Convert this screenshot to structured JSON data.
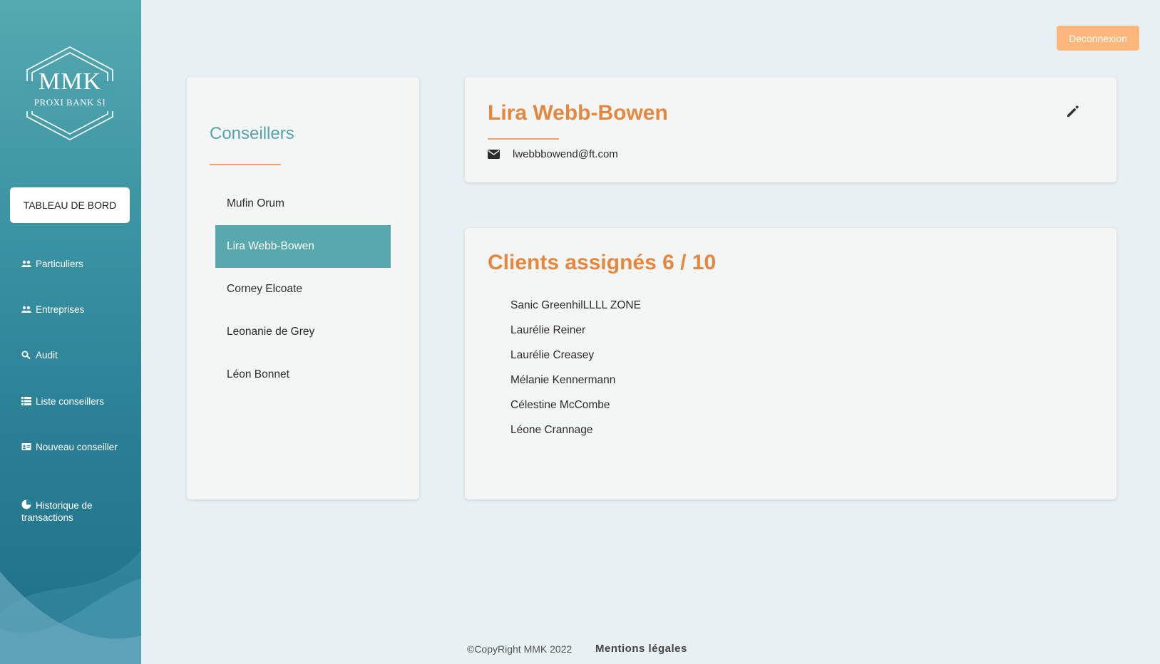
{
  "sidebar": {
    "logo": {
      "brand": "MMK",
      "subtitle": "PROXI BANK SI"
    },
    "dashboard_label": "TABLEAU DE BORD",
    "items": [
      {
        "label": "Particuliers",
        "icon": "users-icon"
      },
      {
        "label": "Entreprises",
        "icon": "users-icon"
      },
      {
        "label": "Audit",
        "icon": "search-icon"
      },
      {
        "label": "Liste conseillers",
        "icon": "list-icon"
      },
      {
        "label": "Nouveau conseiller",
        "icon": "id-card-icon"
      },
      {
        "label": "Historique de transactions",
        "icon": "pie-chart-icon"
      }
    ]
  },
  "header": {
    "logout_label": "Deconnexion"
  },
  "advisors_panel": {
    "title": "Conseillers",
    "items": [
      "Mufin Orum",
      "Lira Webb-Bowen",
      "Corney Elcoate",
      "Leonanie de Grey",
      "Léon Bonnet"
    ],
    "selected": "Lira Webb-Bowen"
  },
  "advisor_detail": {
    "name": "Lira Webb-Bowen",
    "email": "lwebbbowend@ft.com"
  },
  "clients": {
    "title": "Clients assignés 6 / 10",
    "items": [
      "Sanic GreenhilLLLL ZONE",
      "Laurélie Reiner",
      "Laurélie Creasey",
      "Mélanie Kennermann",
      "Célestine McCombe",
      "Léone Crannage"
    ]
  },
  "footer": {
    "copyright": "©CopyRight MMK 2022",
    "legal": "Mentions légales"
  },
  "colors": {
    "accent_teal": "#57a9ad",
    "accent_orange": "#e48840",
    "logout_bg": "#fdb77c",
    "background": "#e7f0f2"
  }
}
